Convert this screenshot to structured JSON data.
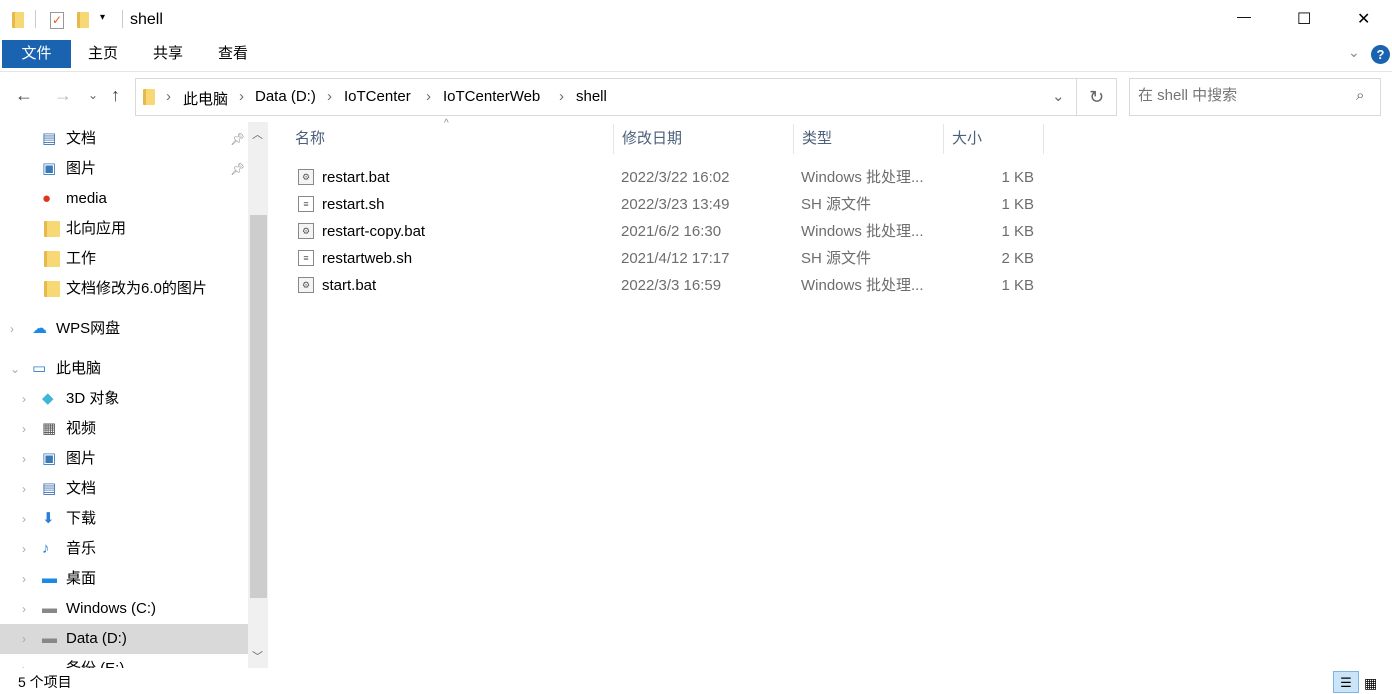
{
  "window": {
    "title": "shell",
    "minimize": "—",
    "maximize": "☐",
    "close": "✕"
  },
  "ribbon": {
    "tabs": [
      "文件",
      "主页",
      "共享",
      "查看"
    ],
    "help": "?"
  },
  "address": {
    "crumbs": [
      "此电脑",
      "Data (D:)",
      "IoTCenter",
      "IoTCenterWeb",
      "shell"
    ]
  },
  "search": {
    "placeholder": "在 shell 中搜索"
  },
  "nav": {
    "items": [
      {
        "label": "文档",
        "icon": "document-icon",
        "pinned": true
      },
      {
        "label": "图片",
        "icon": "picture-icon",
        "pinned": true
      },
      {
        "label": "media",
        "icon": "media-icon"
      },
      {
        "label": "北向应用",
        "icon": "folder-icon"
      },
      {
        "label": "工作",
        "icon": "folder-icon"
      },
      {
        "label": "文档修改为6.0的图片",
        "icon": "folder-icon"
      },
      {
        "label": "WPS网盘",
        "icon": "cloud-icon"
      },
      {
        "label": "此电脑",
        "icon": "computer-icon"
      },
      {
        "label": "3D 对象",
        "icon": "3d-icon"
      },
      {
        "label": "视频",
        "icon": "video-icon"
      },
      {
        "label": "图片",
        "icon": "picture-icon"
      },
      {
        "label": "文档",
        "icon": "document-icon"
      },
      {
        "label": "下载",
        "icon": "download-icon"
      },
      {
        "label": "音乐",
        "icon": "music-icon"
      },
      {
        "label": "桌面",
        "icon": "desktop-icon"
      },
      {
        "label": "Windows (C:)",
        "icon": "drive-icon"
      },
      {
        "label": "Data (D:)",
        "icon": "drive-icon"
      },
      {
        "label": "备份 (E:)",
        "icon": "drive-icon"
      }
    ]
  },
  "columns": [
    "名称",
    "修改日期",
    "类型",
    "大小"
  ],
  "files": [
    {
      "name": "restart.bat",
      "date": "2022/3/22 16:02",
      "type": "Windows 批处理...",
      "size": "1 KB",
      "icon": "batch-file-icon"
    },
    {
      "name": "restart.sh",
      "date": "2022/3/23 13:49",
      "type": "SH 源文件",
      "size": "1 KB",
      "icon": "sh-file-icon"
    },
    {
      "name": "restart-copy.bat",
      "date": "2021/6/2 16:30",
      "type": "Windows 批处理...",
      "size": "1 KB",
      "icon": "batch-file-icon"
    },
    {
      "name": "restartweb.sh",
      "date": "2021/4/12 17:17",
      "type": "SH 源文件",
      "size": "2 KB",
      "icon": "sh-file-icon"
    },
    {
      "name": "start.bat",
      "date": "2022/3/3 16:59",
      "type": "Windows 批处理...",
      "size": "1 KB",
      "icon": "batch-file-icon"
    }
  ],
  "status": {
    "count": "5 个项目"
  }
}
